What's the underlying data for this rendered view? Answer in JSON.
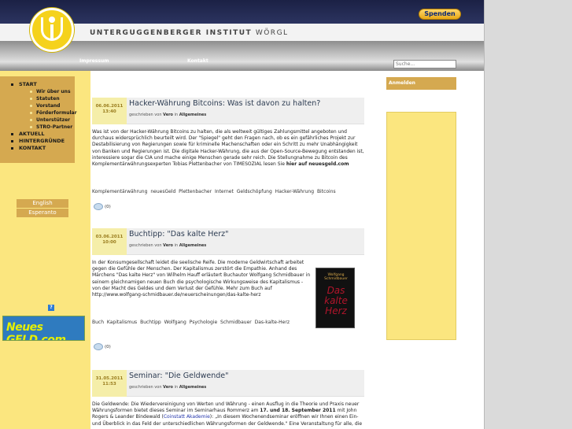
{
  "header": {
    "site_name": "UNTERGUGGENBERGER INSTITUT",
    "site_place": "WÖRGL",
    "donate_label": "Spenden",
    "nav": [
      "Impressum",
      "Kontakt"
    ],
    "search_placeholder": "Suche..."
  },
  "sidebar": {
    "menu": [
      {
        "label": "START",
        "level": 1
      },
      {
        "label": "Wir über uns",
        "level": 2
      },
      {
        "label": "Statuten",
        "level": 2
      },
      {
        "label": "Vorstand",
        "level": 2
      },
      {
        "label": "Förderformular",
        "level": 2
      },
      {
        "label": "Unterstützer",
        "level": 2
      },
      {
        "label": "STRO-Partner",
        "level": 2
      },
      {
        "label": "AKTUELL",
        "level": 1
      },
      {
        "label": "HINTERGRÜNDE",
        "level": 1
      },
      {
        "label": "KONTAKT",
        "level": 1
      }
    ],
    "languages": [
      "English",
      "Esperanto"
    ],
    "help_icon_label": "?",
    "banner_text": "Neues GELD.com"
  },
  "right": {
    "login_label": "Anmelden"
  },
  "posts": [
    {
      "date": "06.06.2011",
      "time": "13:40",
      "title": "Hacker-Währung Bitcoins: Was ist davon zu halten?",
      "meta_prefix": "geschrieben von",
      "author": "Vero",
      "meta_in": "in",
      "category": "Allgemeines",
      "body": "Was ist von der Hacker-Währung Bitcoins zu halten, die als weltweit gültiges Zahlungsmittel angeboten und durchaus widersprüchlich beurteilt wird. Der \"Spiegel\" geht den Fragen nach, ob es ein gefährliches Projekt zur Destabilisierung von Regierungen sowie für kriminelle Machenschaften oder ein Schritt zu mehr Unabhängigkeit von Banken und Regierungen ist. Die digitale Hacker-Währung, die aus der Open-Source-Bewegung entstanden ist, interessiere sogar die CIA und mache einige Menschen gerade sehr reich. Die Stellungnahme zu Bitcoin des Komplementärwährungsexperten Tobias Plettenbacher von TIMESOZIAL lesen Sie",
      "body_link": "hier auf neuesgeld.com",
      "tags": "Komplementärwährung neuesGeld Plettenbacher Internet Geldschöpfung Hacker-Währung Bitcoins",
      "comments": "(0)"
    },
    {
      "date": "03.06.2011",
      "time": "10:00",
      "title": "Buchtipp: \"Das kalte Herz\"",
      "meta_prefix": "geschrieben von",
      "author": "Vero",
      "meta_in": "in",
      "category": "Allgemeines",
      "body": " In der Konsumgesellschaft leidet die seelische Reife. Die moderne Geldwirtschaft arbeitet gegen die Gefühle der Menschen. Der Kapitalismus zerstört die Empathie. Anhand des Märchens \"Das kalte Herz\" von Wilhelm Hauff erläutert Buchautor Wolfgang Schmidbauer in seinem gleichnamigen neuen Buch die psychologische Wirkungsweise des Kapitalismus - von der Macht des Geldes und dem Verlust der Gefühle. Mehr zum Buch auf",
      "body_link": "http://www.wolfgang-schmidbauer.de/neuerscheinungen/das-kalte-herz",
      "book_author": "Wolfgang Schmidbauer",
      "book_title": "Das kalte Herz",
      "tags": "Buch Kapitalismus Buchtipp Wolfgang Psychologie Schmidbauer Das-kalte-Herz",
      "comments": "(0)"
    },
    {
      "date": "31.05.2011",
      "time": "11:53",
      "title": "Seminar: \"Die Geldwende\"",
      "meta_prefix": "geschrieben von",
      "author": "Vero",
      "meta_in": "in",
      "category": "Allgemeines",
      "body_a": "Die Geldwende: Die Wiedervereinigung von Werten und Währung -  einen Ausflug in die Theorie und Praxis neuer Währungsformen bietet dieses Seminar im Seminarhaus Rommerz am",
      "body_dates": "17. und 18. September 2011",
      "body_b": "mit John Rogers & Leander Bindewald (",
      "body_link": "Coinstatt Akademie",
      "body_c": "): „In diesem Wochenendseminar eröffnen wir Ihnen einen Ein- und Überblick in das Feld der unterschiedlichen Währungsformen der Geldwende.\" Eine Veranstaltung für alle, die"
    }
  ]
}
